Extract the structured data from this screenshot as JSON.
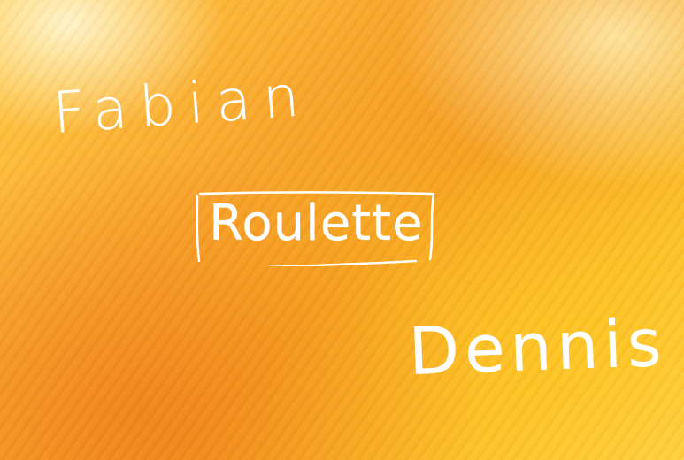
{
  "names": {
    "left": "Fabian",
    "right": "Dennis"
  },
  "title": "Roulette",
  "colors": {
    "background": "#f8a52a",
    "ink": "#ffffff"
  }
}
